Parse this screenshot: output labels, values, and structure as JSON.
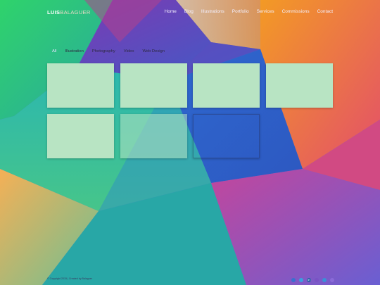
{
  "logo": {
    "part1": "LUIS",
    "part2": "BALAGUER"
  },
  "nav": [
    "Home",
    "Blog",
    "Illustrations",
    "Portfolio",
    "Services",
    "Commissions",
    "Contact"
  ],
  "filters": [
    "All",
    "Illustration",
    "Photography",
    "Video",
    "Web Design"
  ],
  "footer": {
    "copyright": "© Copyright 2015 | Created by Balaguer"
  },
  "social_icons": [
    "github-icon",
    "twitter-icon",
    "linkedin-icon",
    "google-plus-icon",
    "telegram-icon",
    "email-icon"
  ],
  "colors": {
    "card": "#b8e4c3",
    "logo_white": "#ffffff",
    "logo_tan": "#e9d9c6"
  }
}
